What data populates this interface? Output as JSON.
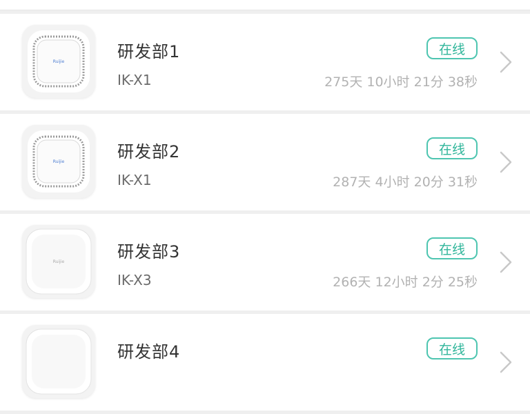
{
  "devices": [
    {
      "name": "研发部1",
      "model": "IK-X1",
      "status": "在线",
      "uptime": "275天 10小时 21分 38秒",
      "thumbnail_icon": "ceiling-ap-ring-icon"
    },
    {
      "name": "研发部2",
      "model": "IK-X1",
      "status": "在线",
      "uptime": "287天 4小时 20分 31秒",
      "thumbnail_icon": "ceiling-ap-ring-icon"
    },
    {
      "name": "研发部3",
      "model": "IK-X3",
      "status": "在线",
      "uptime": "266天 12小时 2分 25秒",
      "thumbnail_icon": "ceiling-ap-plain-icon"
    },
    {
      "name": "研发部4",
      "model": "",
      "status": "在线",
      "uptime": "",
      "thumbnail_icon": "ceiling-ap-plain-icon"
    }
  ],
  "colors": {
    "status_online": "#2fb59a",
    "status_border": "#4dc5b0",
    "page_bg": "#efefef",
    "row_bg": "#ffffff"
  }
}
